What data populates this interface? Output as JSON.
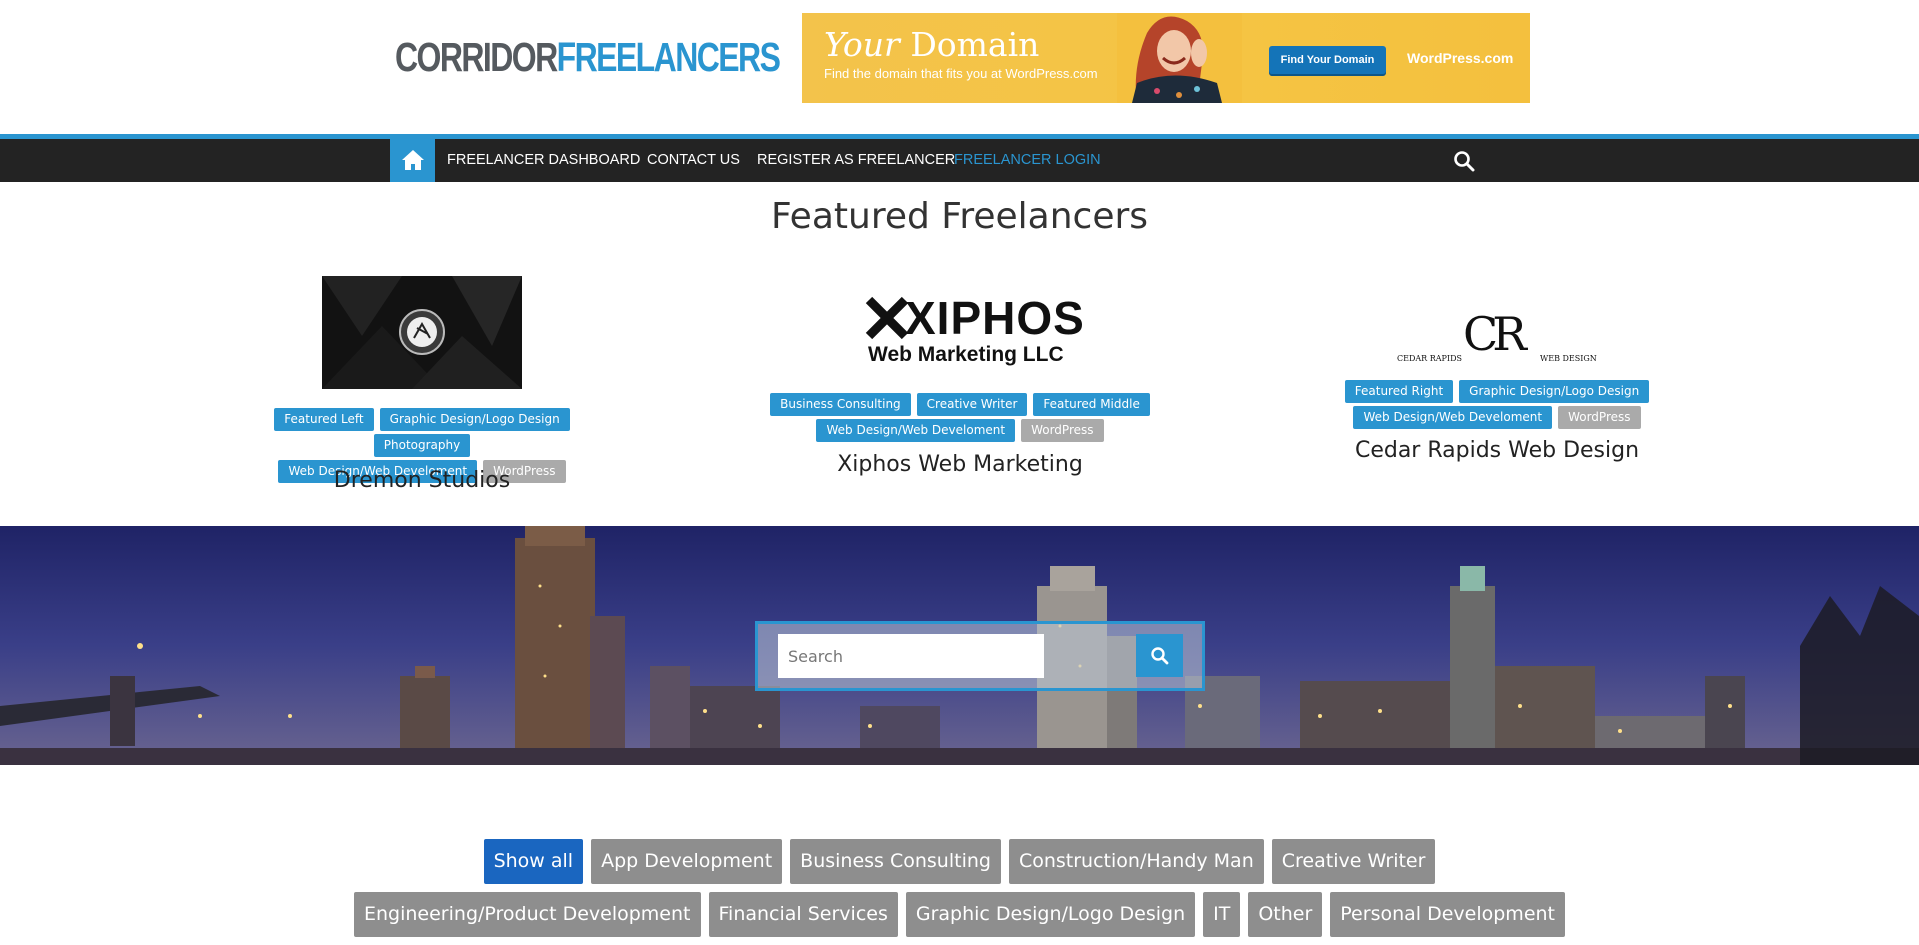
{
  "logo": {
    "part1": "CORRIDOR",
    "part2": "FREELANCERS"
  },
  "ad": {
    "title_italic": "Your",
    "title_rest": " Domain",
    "subtitle": "Find the domain that fits you at WordPress.com",
    "button": "Find Your Domain",
    "brand": "WordPress.com"
  },
  "nav": {
    "items": [
      {
        "label": "FREELANCER DASHBOARD"
      },
      {
        "label": "CONTACT US"
      },
      {
        "label": "REGISTER AS FREELANCER"
      },
      {
        "label": "FREELANCER LOGIN"
      }
    ],
    "active_index": 3
  },
  "featured": {
    "title": "Featured Freelancers",
    "cards": [
      {
        "name": "Dremon Studios",
        "tags": [
          "Featured Left",
          "Graphic Design/Logo Design",
          "Photography",
          "Web Design/Web Develoment",
          "WordPress"
        ]
      },
      {
        "name": "Xiphos Web Marketing",
        "logo_line1": "XIPHOS",
        "logo_line2": "Web Marketing LLC",
        "tags": [
          "Business Consulting",
          "Creative Writer",
          "Featured Middle",
          "Web Design/Web Develoment",
          "WordPress"
        ]
      },
      {
        "name": "Cedar Rapids Web Design",
        "logo_left": "CEDAR RAPIDS",
        "logo_mark": "CR",
        "logo_right": "WEB DESIGN",
        "tags": [
          "Featured Right",
          "Graphic Design/Logo Design",
          "Web Design/Web Develoment",
          "WordPress"
        ]
      }
    ]
  },
  "search": {
    "placeholder": "Search"
  },
  "categories": [
    "Show all",
    "App Development",
    "Business Consulting",
    "Construction/Handy Man",
    "Creative Writer",
    "Engineering/Product Development",
    "Financial Services",
    "Graphic Design/Logo Design",
    "IT",
    "Other",
    "Personal Development"
  ],
  "colors": {
    "accent": "#2a95d0",
    "nav_bg": "#232323",
    "tag_grey": "#aaaaaa",
    "filter_active": "#1a66c0",
    "filter_bg": "#8e8e8e"
  }
}
